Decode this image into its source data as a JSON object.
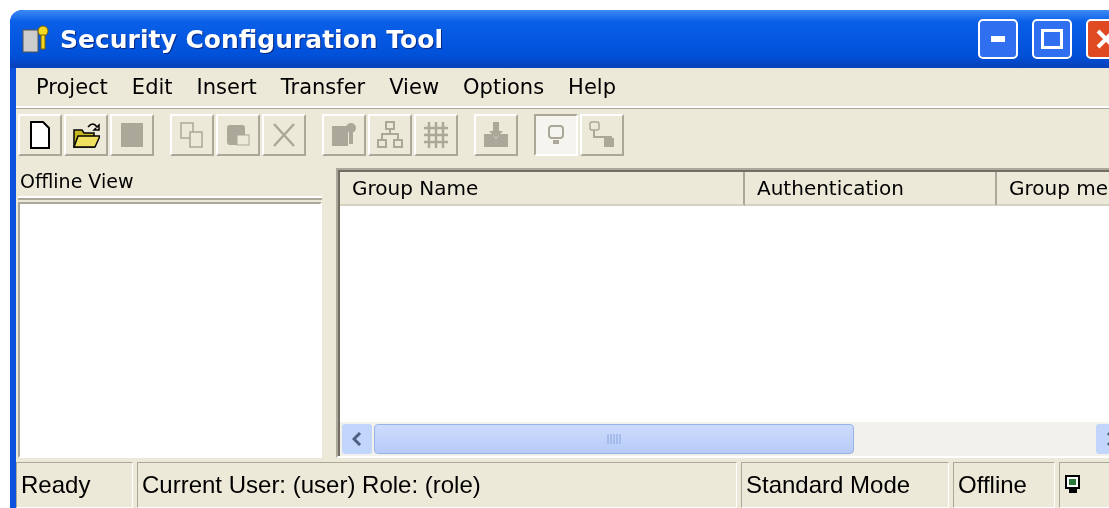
{
  "window": {
    "title": "Security Configuration Tool"
  },
  "menu": [
    "Project",
    "Edit",
    "Insert",
    "Transfer",
    "View",
    "Options",
    "Help"
  ],
  "toolbar": [
    {
      "kind": "new",
      "disabled": false,
      "pressed": false
    },
    {
      "kind": "open",
      "disabled": false,
      "pressed": false
    },
    {
      "kind": "save",
      "disabled": true,
      "pressed": false
    },
    {
      "kind": "copy",
      "disabled": true,
      "pressed": false
    },
    {
      "kind": "paste",
      "disabled": true,
      "pressed": false
    },
    {
      "kind": "delete",
      "disabled": true,
      "pressed": false
    },
    {
      "kind": "server",
      "disabled": true,
      "pressed": false
    },
    {
      "kind": "tree",
      "disabled": true,
      "pressed": false
    },
    {
      "kind": "grid",
      "disabled": true,
      "pressed": false
    },
    {
      "kind": "download",
      "disabled": true,
      "pressed": false
    },
    {
      "kind": "offline",
      "disabled": true,
      "pressed": true
    },
    {
      "kind": "online",
      "disabled": true,
      "pressed": false
    }
  ],
  "left_pane": {
    "title": "Offline View"
  },
  "table": {
    "columns": [
      "Group Name",
      "Authentication",
      "Group me"
    ]
  },
  "status_bar": [
    "Ready",
    "Current User: (user) Role: (role)",
    "Standard Mode",
    "Offline"
  ]
}
